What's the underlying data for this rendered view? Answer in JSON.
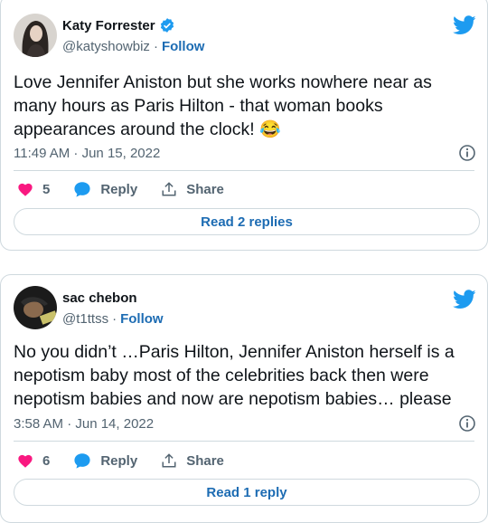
{
  "tweets": [
    {
      "name": "Katy Forrester",
      "handle": "@katyshowbiz",
      "follow_label": "Follow",
      "separator": "·",
      "text": "Love Jennifer Aniston but she works nowhere near as many hours as Paris Hilton - that woman books appearances around the clock!",
      "emoji": "😂",
      "timestamp": "11:49 AM · Jun 15, 2022",
      "likes": "5",
      "reply_label": "Reply",
      "share_label": "Share",
      "replies_label": "Read 2 replies",
      "verified": true
    },
    {
      "name": "sac chebon",
      "handle": "@t1ttss",
      "follow_label": "Follow",
      "separator": "·",
      "text": "No you didn’t …Paris Hilton, Jennifer Aniston herself is a nepotism baby most of the celebrities back then were nepotism babies and now are nepotism babies… please",
      "timestamp": "3:58 AM · Jun 14, 2022",
      "likes": "6",
      "reply_label": "Reply",
      "share_label": "Share",
      "replies_label": "Read 1 reply",
      "verified": false
    }
  ],
  "colors": {
    "twitter_blue": "#1d9bf0",
    "link_blue": "#1d6cb3",
    "heart": "#f91880",
    "muted": "#536471",
    "border": "#cfd9de"
  },
  "icons": [
    "verified-badge-icon",
    "twitter-bird-icon",
    "info-icon",
    "heart-icon",
    "reply-bubble-icon",
    "share-icon"
  ]
}
